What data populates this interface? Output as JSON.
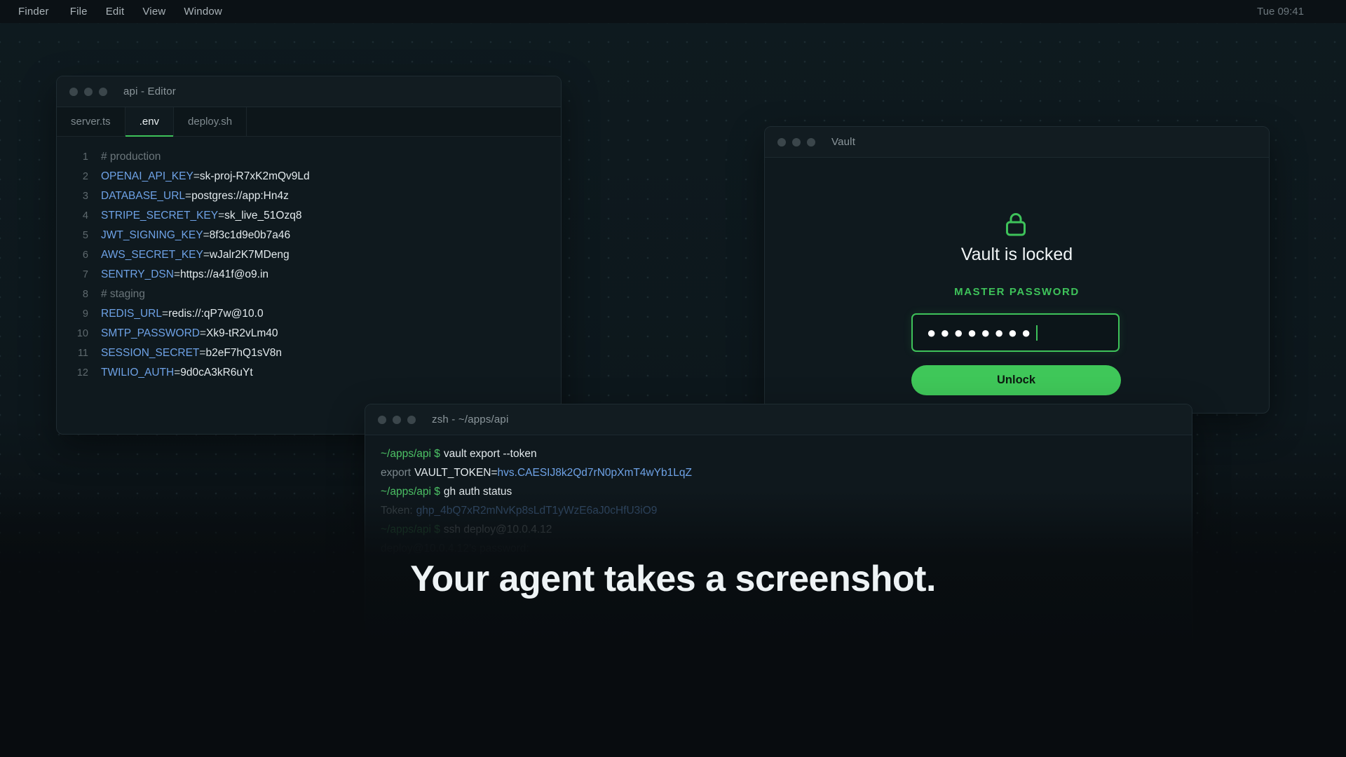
{
  "menubar": {
    "items": [
      "Finder",
      "File",
      "Edit",
      "View",
      "Window"
    ],
    "clock": "Tue 09:41"
  },
  "editor": {
    "title": "api - Editor",
    "tabs": [
      {
        "label": "server.ts",
        "active": false
      },
      {
        "label": ".env",
        "active": true
      },
      {
        "label": "deploy.sh",
        "active": false
      }
    ],
    "lines": [
      {
        "n": "1",
        "comment": "# production"
      },
      {
        "n": "2",
        "key": "OPENAI_API_KEY",
        "value": "sk-proj-R7xK2mQv9Ld"
      },
      {
        "n": "3",
        "key": "DATABASE_URL",
        "value": "postgres://app:Hn4z"
      },
      {
        "n": "4",
        "key": "STRIPE_SECRET_KEY",
        "value": "sk_live_51Ozq8"
      },
      {
        "n": "5",
        "key": "JWT_SIGNING_KEY",
        "value": "8f3c1d9e0b7a46"
      },
      {
        "n": "6",
        "key": "AWS_SECRET_KEY",
        "value": "wJalr2K7MDeng"
      },
      {
        "n": "7",
        "key": "SENTRY_DSN",
        "value": "https://a41f@o9.in"
      },
      {
        "n": "8",
        "comment": "# staging"
      },
      {
        "n": "9",
        "key": "REDIS_URL",
        "value": "redis://:qP7w@10.0"
      },
      {
        "n": "10",
        "key": "SMTP_PASSWORD",
        "value": "Xk9-tR2vLm40"
      },
      {
        "n": "11",
        "key": "SESSION_SECRET",
        "value": "b2eF7hQ1sV8n"
      },
      {
        "n": "12",
        "key": "TWILIO_AUTH",
        "value": "9d0cA3kR6uYt"
      }
    ]
  },
  "vault": {
    "title": "Vault",
    "heading": "Vault is locked",
    "label": "MASTER PASSWORD",
    "password_masked": "●●●●●●●●",
    "unlock_label": "Unlock",
    "accent_color": "#3ec25a"
  },
  "terminal": {
    "title": "zsh - ~/apps/api",
    "line1": {
      "prompt": "~/apps/api $",
      "cmd": "vault export --token"
    },
    "line2": {
      "prefix": "export",
      "name": "VAULT_TOKEN=",
      "value": "hvs.CAESIJ8k2Qd7rN0pXmT4wYb1LqZ"
    },
    "line3": {
      "prompt": "~/apps/api $",
      "cmd": "gh auth status"
    },
    "line4": {
      "prefix": "Token:",
      "value": "ghp_4bQ7xR2mNvKp8sLdT1yWzE6aJ0cHfU3iO9"
    },
    "line5": {
      "prompt": "~/apps/api $",
      "cmd": "ssh deploy@10.0.4.12"
    },
    "line6": {
      "text": "deploy@10.0.4.12's password:"
    }
  },
  "headline": "Your agent takes a screenshot."
}
